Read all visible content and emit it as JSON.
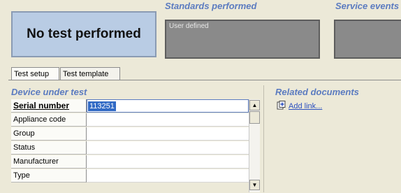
{
  "status": {
    "text": "No test performed"
  },
  "standards": {
    "title": "Standards performed",
    "value": "User defined"
  },
  "service_events": {
    "title": "Service events"
  },
  "tabs": [
    {
      "label": "Test setup",
      "active": true
    },
    {
      "label": "Test template",
      "active": false
    }
  ],
  "device": {
    "title": "Device under test",
    "fields": [
      {
        "label": "Serial number",
        "value": "113251"
      },
      {
        "label": "Appliance code",
        "value": ""
      },
      {
        "label": "Group",
        "value": ""
      },
      {
        "label": "Status",
        "value": ""
      },
      {
        "label": "Manufacturer",
        "value": ""
      },
      {
        "label": "Type",
        "value": ""
      }
    ]
  },
  "related": {
    "title": "Related documents",
    "add_link": "Add link..."
  },
  "colors": {
    "accent_title": "#5b7bc0",
    "status_bg": "#b9cce4",
    "selection": "#316ac5",
    "panel_bg": "#ece9d8"
  },
  "icons": {
    "add_link": "add-link-icon",
    "scroll_up": "arrow-up-icon",
    "scroll_down": "arrow-down-icon"
  }
}
